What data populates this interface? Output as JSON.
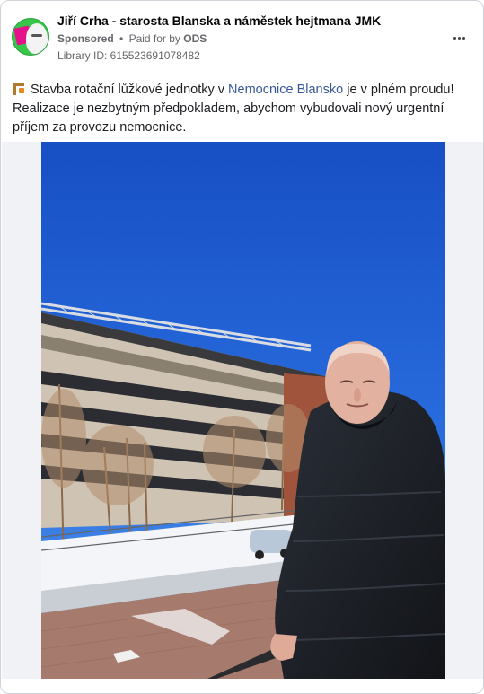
{
  "advertiser": {
    "name": "Jiří Crha - starosta Blanska a náměstek hejtmana JMK",
    "sponsored_label": "Sponsored",
    "separator": "•",
    "paid_for_prefix": "Paid for by",
    "paid_for_by": "ODS",
    "library_id": "Library ID: 615523691078482"
  },
  "post": {
    "text_before_link": "Stavba rotační lůžkové jednotky v ",
    "link_text": "Nemocnice Blansko",
    "text_after_link": " je v plném proudu! Realizace je nezbytným předpokladem, abychom vybudovali nový urgentní příjem za provozu nemocnice.",
    "emoji": "construction-crane-icon"
  },
  "colors": {
    "link": "#385898",
    "sky": "#1e63d6",
    "jacket": "#1b1f26",
    "avatar_green": "#36c64a",
    "badge_pink": "#e5118b"
  }
}
